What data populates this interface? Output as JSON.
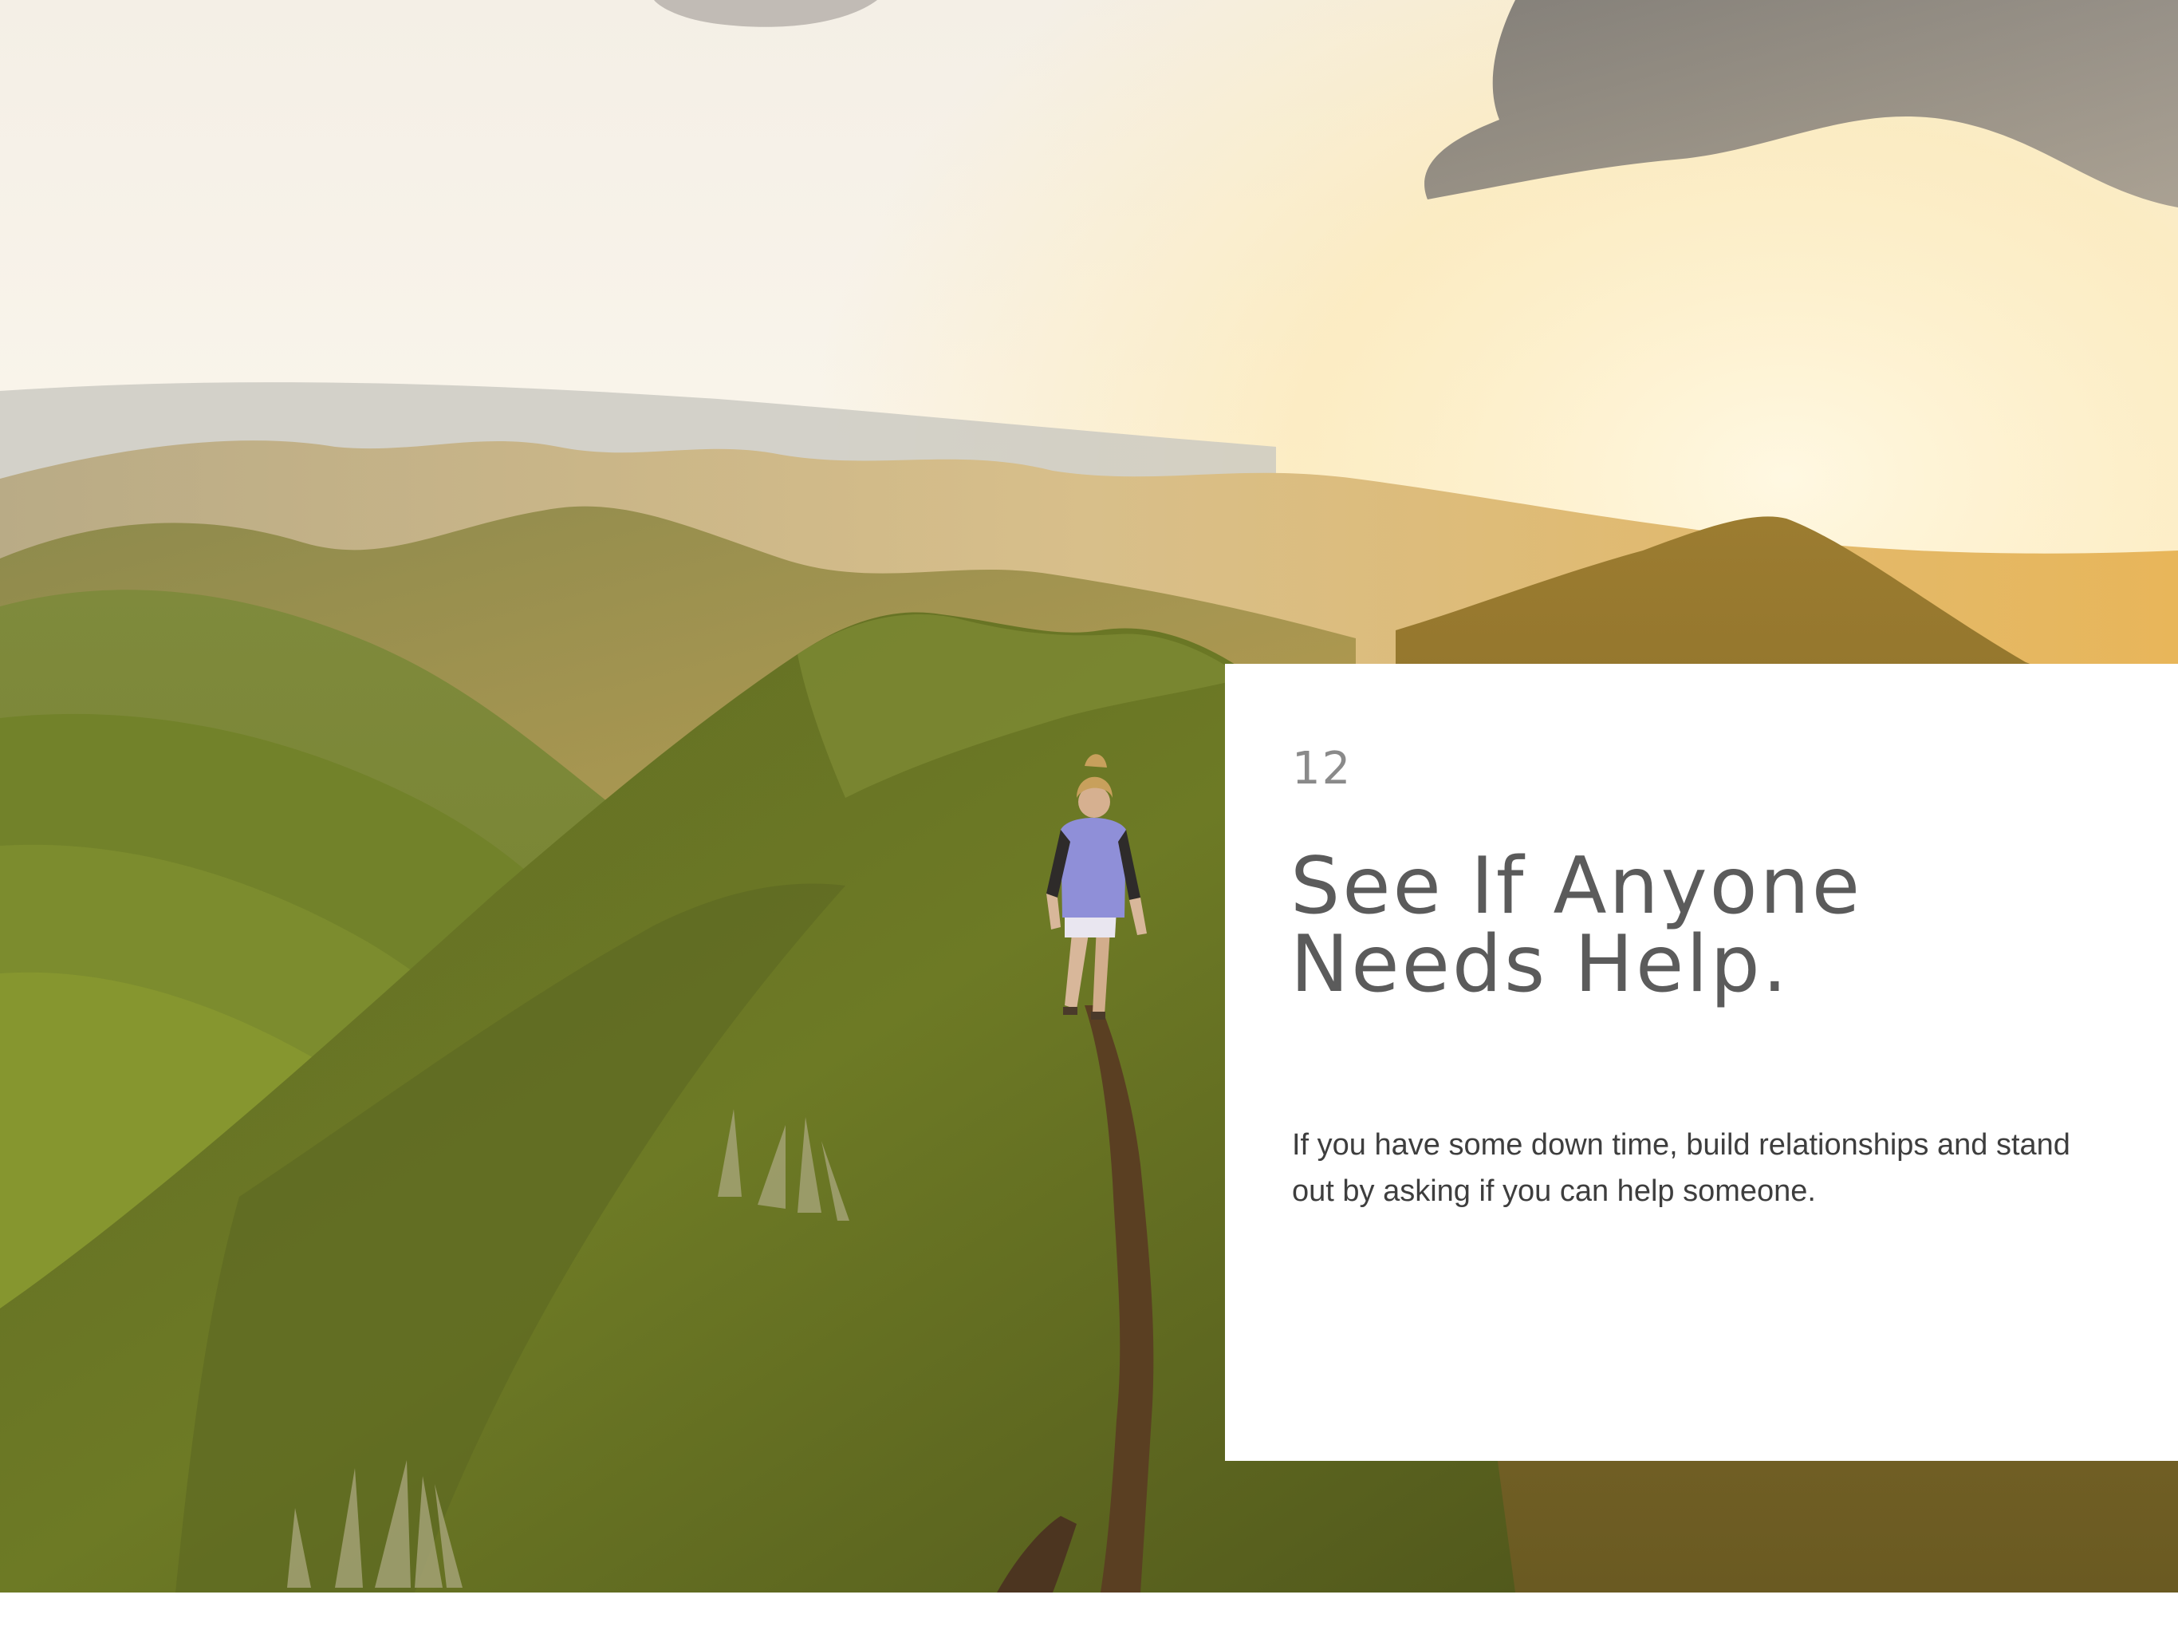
{
  "slide": {
    "number": "12",
    "title": "See If Anyone Needs Help.",
    "body": "If you have some down time, build relationships and stand out by asking if you can help someone."
  },
  "colors": {
    "card_background": "#ffffff",
    "number_text": "#8a8a8a",
    "title_text": "#5b5b5b",
    "body_text": "#3e3e3e"
  }
}
